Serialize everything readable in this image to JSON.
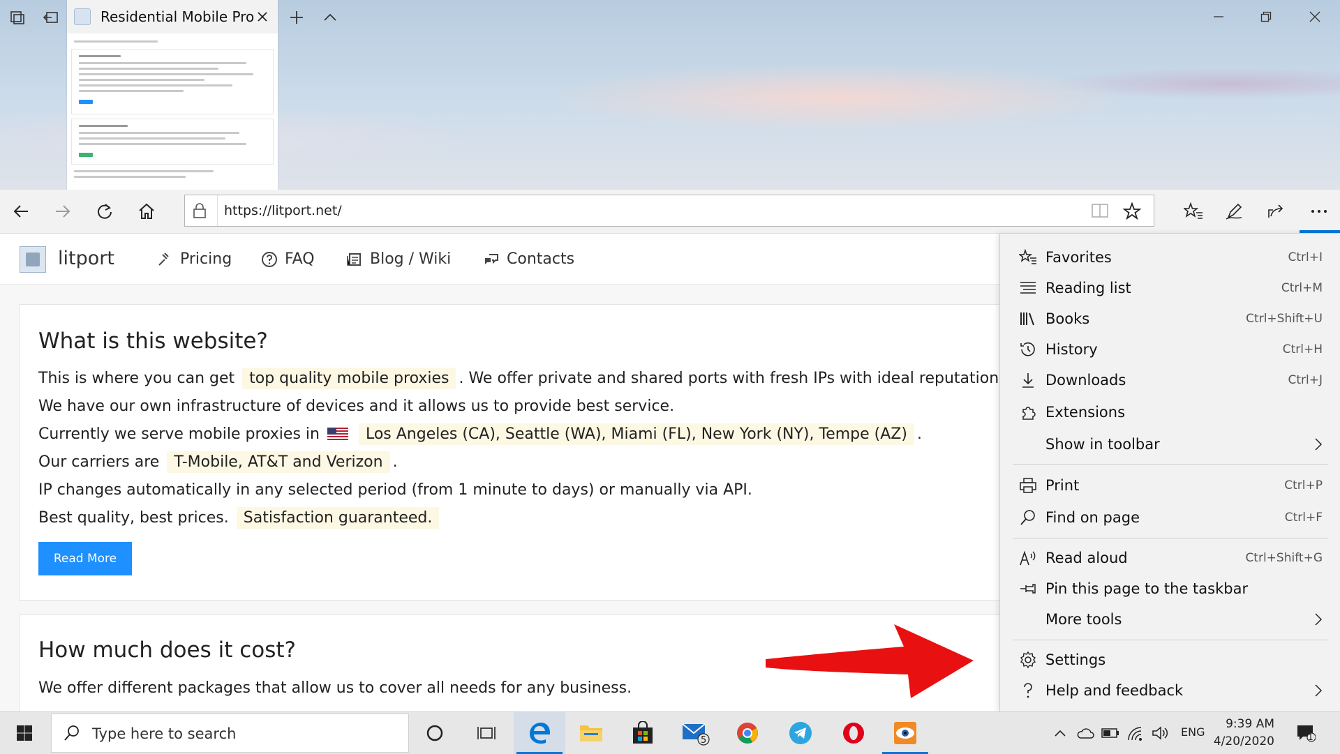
{
  "window": {
    "tab_title": "Residential Mobile Prox"
  },
  "toolbar": {
    "url": "https://litport.net/"
  },
  "site": {
    "name": "litport",
    "nav": [
      "Pricing",
      "FAQ",
      "Blog / Wiki",
      "Contacts"
    ],
    "card1": {
      "title": "What is this website?",
      "l1_pre": "This is where you can get",
      "l1_hl": "top quality mobile proxies",
      "l1_post": ". We offer private and shared ports with fresh IPs with ideal reputation.",
      "l2": "We have our own infrastructure of devices and it allows us to provide best service.",
      "l3_pre": "Currently we serve mobile proxies in",
      "l3_hl": "Los Angeles (CA), Seattle (WA), Miami (FL), New York (NY), Tempe (AZ)",
      "l3_post": ".",
      "l4_pre": "Our carriers are",
      "l4_hl": "T-Mobile, AT&T and Verizon",
      "l4_post": ".",
      "l5": "IP changes automatically in any selected period (from 1 minute to days) or manually via API.",
      "l6_pre": "Best quality, best prices.",
      "l6_hl": "Satisfaction guaranteed.",
      "button": "Read More"
    },
    "card2": {
      "title": "How much does it cost?",
      "l1": "We offer different packages that allow us to cover all needs for any business."
    }
  },
  "menu": {
    "items": [
      {
        "label": "Favorites",
        "shortcut": "Ctrl+I",
        "icon": "favorites-icon"
      },
      {
        "label": "Reading list",
        "shortcut": "Ctrl+M",
        "icon": "reading-list-icon"
      },
      {
        "label": "Books",
        "shortcut": "Ctrl+Shift+U",
        "icon": "books-icon"
      },
      {
        "label": "History",
        "shortcut": "Ctrl+H",
        "icon": "history-icon"
      },
      {
        "label": "Downloads",
        "shortcut": "Ctrl+J",
        "icon": "download-icon"
      },
      {
        "label": "Extensions",
        "shortcut": "",
        "icon": "extensions-icon"
      },
      {
        "label": "Show in toolbar",
        "shortcut": "",
        "icon": ""
      },
      {
        "label": "Print",
        "shortcut": "Ctrl+P",
        "icon": "print-icon"
      },
      {
        "label": "Find on page",
        "shortcut": "Ctrl+F",
        "icon": "find-icon"
      },
      {
        "label": "Read aloud",
        "shortcut": "Ctrl+Shift+G",
        "icon": "read-aloud-icon"
      },
      {
        "label": "Pin this page to the taskbar",
        "shortcut": "",
        "icon": "pin-icon"
      },
      {
        "label": "More tools",
        "shortcut": "",
        "icon": ""
      },
      {
        "label": "Settings",
        "shortcut": "",
        "icon": "settings-icon"
      },
      {
        "label": "Help and feedback",
        "shortcut": "",
        "icon": "help-icon"
      }
    ]
  },
  "taskbar": {
    "search_placeholder": "Type here to search",
    "mail_badge": "5",
    "notification_badge": "1",
    "language": "ENG",
    "time": "9:39 AM",
    "date": "4/20/2020"
  },
  "colors": {
    "accent": "#0078d7",
    "button": "#1e90ff",
    "highlight": "#fdf8e4",
    "arrow": "#e81010"
  }
}
